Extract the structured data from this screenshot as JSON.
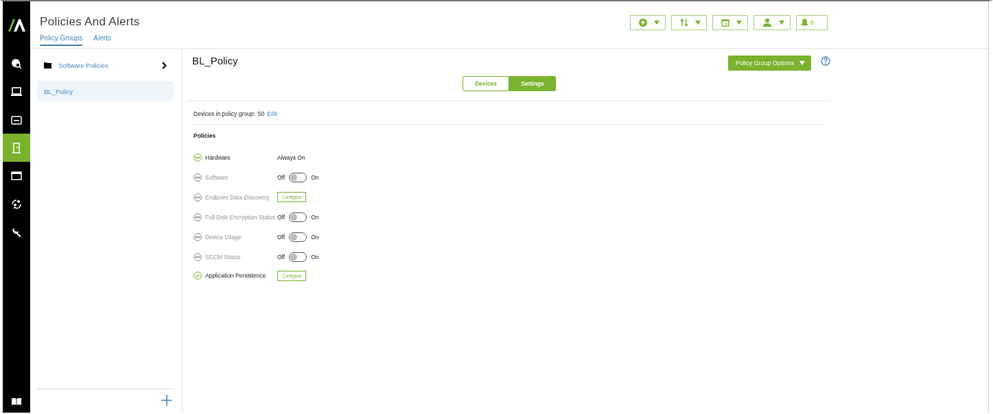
{
  "nav": [
    {
      "selected": false
    },
    {
      "selected": false
    },
    {
      "selected": false
    },
    {
      "selected": false
    },
    {
      "selected": true
    },
    {
      "selected": false
    },
    {
      "selected": false
    },
    {
      "selected": false
    }
  ],
  "header": {
    "title": "Policies And Alerts",
    "tabs": [
      {
        "label": "Policy Groups",
        "selected": true
      },
      {
        "label": "Alerts",
        "selected": false
      }
    ],
    "tools": [
      {
        "kind": "dropdown"
      },
      {
        "kind": "dropdown"
      },
      {
        "kind": "dropdown"
      },
      {
        "kind": "dropdown"
      },
      {
        "kind": "counter",
        "count": "0"
      }
    ]
  },
  "groups": [
    {
      "label": "Software Policies",
      "kind": "folder",
      "selected": false
    },
    {
      "label": "BL_Policy",
      "kind": "item",
      "selected": true
    }
  ],
  "detail": {
    "title": "BL_Policy",
    "options": "Policy Group Options",
    "views": [
      {
        "label": "Devices",
        "selected": false
      },
      {
        "label": "Settings",
        "selected": true
      }
    ],
    "devices_label": "Devices in policy group:",
    "devices_count": "50",
    "edit": "Edit",
    "policies_title": "Policies",
    "policies": [
      {
        "name": "Hardware",
        "enabled": true,
        "kind": "text",
        "value": "Always On"
      },
      {
        "name": "Software",
        "enabled": false,
        "kind": "toggle",
        "on": false,
        "off_label": "Off",
        "on_label": "On"
      },
      {
        "name": "Endpoint Data Discovery",
        "enabled": false,
        "kind": "button",
        "value": "Configure"
      },
      {
        "name": "Full-Disk Encryption Status",
        "enabled": false,
        "kind": "toggle",
        "on": false,
        "off_label": "Off",
        "on_label": "On"
      },
      {
        "name": "Device Usage",
        "enabled": false,
        "kind": "toggle",
        "on": false,
        "off_label": "Off",
        "on_label": "On"
      },
      {
        "name": "SCCM Status",
        "enabled": false,
        "kind": "toggle",
        "on": false,
        "off_label": "Off",
        "on_label": "On"
      },
      {
        "name": "Application Persistence",
        "enabled": true,
        "kind": "button",
        "value": "Configure"
      }
    ]
  }
}
